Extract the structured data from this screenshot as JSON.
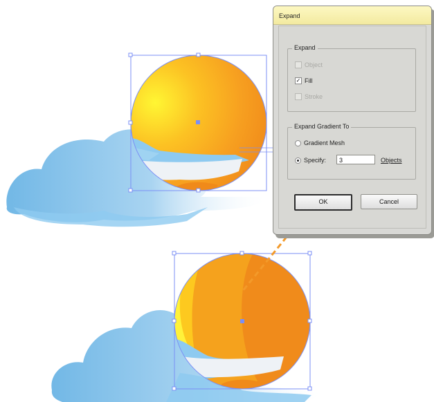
{
  "dialog": {
    "title": "Expand",
    "expand_group": {
      "legend": "Expand",
      "options": [
        {
          "label": "Object",
          "checked": false,
          "enabled": false
        },
        {
          "label": "Fill",
          "checked": true,
          "enabled": true
        },
        {
          "label": "Stroke",
          "checked": false,
          "enabled": false
        }
      ]
    },
    "gradient_group": {
      "legend": "Expand Gradient To",
      "gradient_mesh_label": "Gradient Mesh",
      "specify_label": "Specify:",
      "specify_value": "3",
      "objects_label": "Objects"
    },
    "ok_label": "OK",
    "cancel_label": "Cancel"
  },
  "colors": {
    "selection": "#7b8ff5",
    "annotation_arrow": "#f39a2a",
    "dialog_title": "#f7f0b2",
    "sun_orange": "#f2921c",
    "cloud_blue": "#7cc0ea"
  }
}
